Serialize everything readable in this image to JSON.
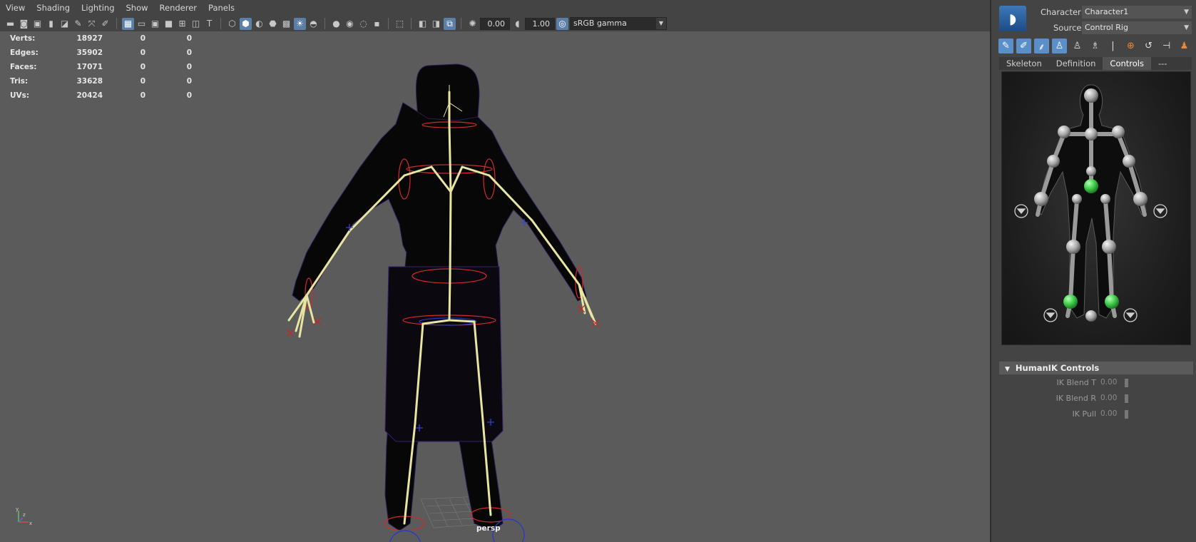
{
  "viewport": {
    "menu": [
      "View",
      "Shading",
      "Lighting",
      "Show",
      "Renderer",
      "Panels"
    ],
    "toolbar": {
      "field1": "0.00",
      "field2": "1.00",
      "colorspace": "sRGB gamma"
    },
    "hud": [
      {
        "label": "Verts:",
        "v1": "18927",
        "v2": "0",
        "v3": "0"
      },
      {
        "label": "Edges:",
        "v1": "35902",
        "v2": "0",
        "v3": "0"
      },
      {
        "label": "Faces:",
        "v1": "17071",
        "v2": "0",
        "v3": "0"
      },
      {
        "label": "Tris:",
        "v1": "33628",
        "v2": "0",
        "v3": "0"
      },
      {
        "label": "UVs:",
        "v1": "20424",
        "v2": "0",
        "v3": "0"
      }
    ],
    "camera": "persp",
    "axis": {
      "x": "x",
      "y": "y",
      "z": "z"
    }
  },
  "hik": {
    "character_label": "Character:",
    "character_value": "Character1",
    "source_label": "Source:",
    "source_value": "Control Rig",
    "tabs": [
      "Skeleton",
      "Definition",
      "Controls",
      "---"
    ],
    "active_tab": "Controls",
    "controls_header": "HumanIK Controls",
    "sliders": [
      {
        "label": "IK Blend T",
        "value": "0.00"
      },
      {
        "label": "IK Blend R",
        "value": "0.00"
      },
      {
        "label": "IK Pull",
        "value": "0.00"
      }
    ],
    "colors": {
      "accent": "#5b8fc9",
      "active_effector": "#3fcf4a"
    }
  }
}
